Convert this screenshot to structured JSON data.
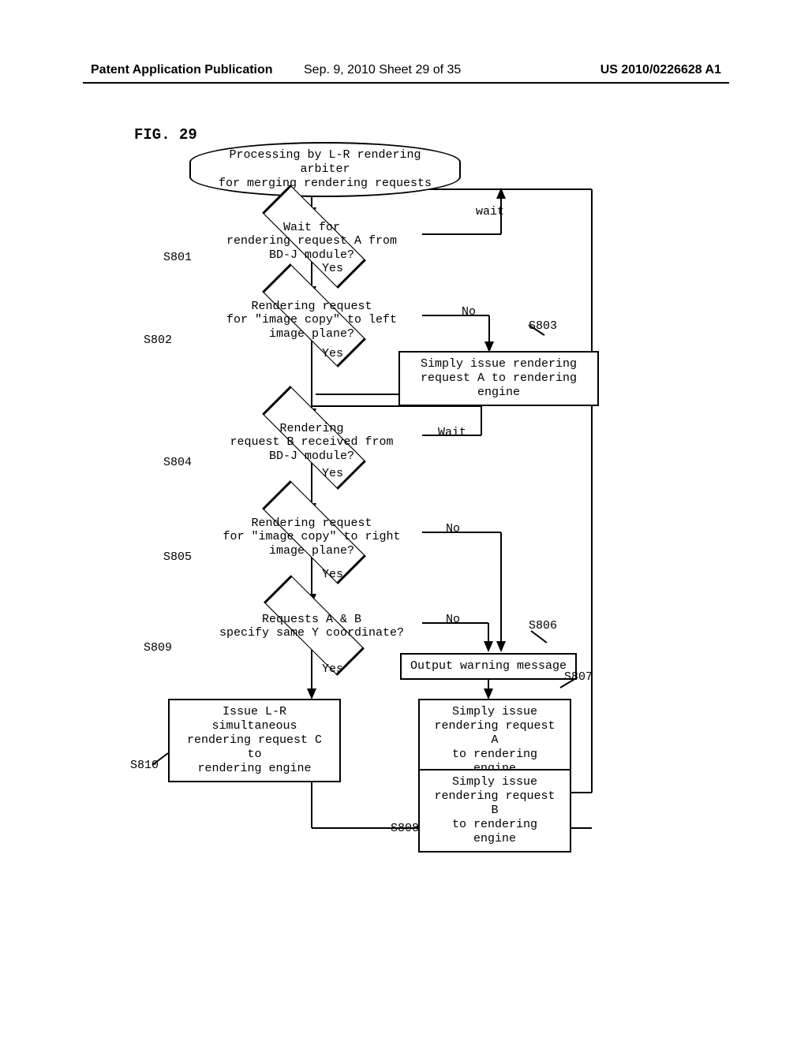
{
  "header": {
    "left": "Patent Application Publication",
    "center": "Sep. 9, 2010  Sheet 29 of 35",
    "right": "US 2010/0226628 A1"
  },
  "figure_label": "FIG. 29",
  "chart_data": {
    "type": "flowchart",
    "title": "Processing by L-R rendering arbiter for merging rendering requests",
    "nodes": [
      {
        "id": "start",
        "type": "terminator",
        "text_line1": "Processing by L-R rendering arbiter",
        "text_line2": "for merging rendering requests"
      },
      {
        "id": "S801",
        "type": "decision",
        "text_line1": "Wait for",
        "text_line2": "rendering request A from",
        "text_line3": "BD-J module?",
        "yes": "S802",
        "no_label": "wait",
        "no": "loop"
      },
      {
        "id": "S802",
        "type": "decision",
        "text_line1": "Rendering request",
        "text_line2": "for \"image copy\" to left",
        "text_line3": "image plane?",
        "yes": "S804",
        "no": "S803"
      },
      {
        "id": "S803",
        "type": "process",
        "text_line1": "Simply issue rendering",
        "text_line2": "request A to rendering engine",
        "next": "loop"
      },
      {
        "id": "S804",
        "type": "decision",
        "text_line1": "Rendering",
        "text_line2": "request B received from",
        "text_line3": "BD-J module?",
        "yes": "S805",
        "no_label": "Wait",
        "no": "self"
      },
      {
        "id": "S805",
        "type": "decision",
        "text_line1": "Rendering request",
        "text_line2": "for \"image copy\" to right",
        "text_line3": "image plane?",
        "yes": "S809",
        "no": "S806"
      },
      {
        "id": "S809",
        "type": "decision",
        "text_line1": "Requests A & B",
        "text_line2": "specify same Y coordinate?",
        "yes": "S810",
        "no": "S806"
      },
      {
        "id": "S806",
        "type": "process",
        "text": "Output warning message",
        "next": "S807"
      },
      {
        "id": "S807",
        "type": "process",
        "text_line1": "Simply issue",
        "text_line2": "rendering request A",
        "text_line3": "to rendering engine",
        "next": "S808"
      },
      {
        "id": "S808",
        "type": "process",
        "text_line1": "Simply issue",
        "text_line2": "rendering request B",
        "text_line3": "to rendering engine",
        "next": "loop"
      },
      {
        "id": "S810",
        "type": "process",
        "text_line1": "Issue L-R simultaneous",
        "text_line2": "rendering request C to",
        "text_line3": "rendering engine",
        "next": "loop"
      }
    ]
  },
  "labels": {
    "yes": "Yes",
    "no": "No",
    "wait1": "wait",
    "wait2": "Wait"
  },
  "steps": {
    "s801": "S801",
    "s802": "S802",
    "s803": "S803",
    "s804": "S804",
    "s805": "S805",
    "s806": "S806",
    "s807": "S807",
    "s808": "S808",
    "s809": "S809",
    "s810": "S810"
  }
}
